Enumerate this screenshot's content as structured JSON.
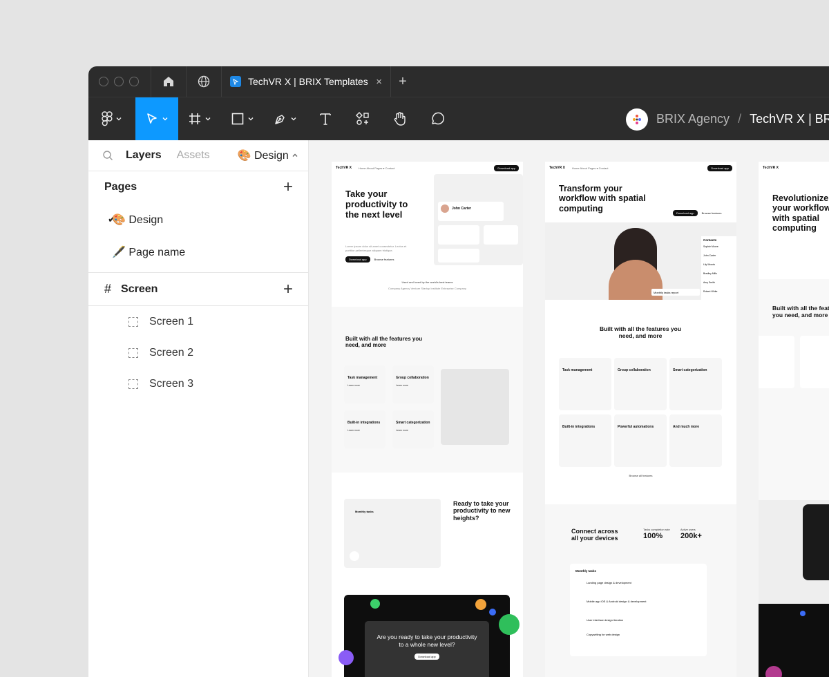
{
  "tabbar": {
    "tab_title": "TechVR X | BRIX Templates",
    "close_glyph": "×",
    "new_tab_glyph": "+"
  },
  "toolbar": {
    "breadcrumb_team": "BRIX Agency",
    "breadcrumb_sep": "/",
    "breadcrumb_file": "TechVR X | BRIX Templates",
    "active_tool": "move",
    "accent": "#0d99ff"
  },
  "sidebar": {
    "tabs": {
      "layers": "Layers",
      "assets": "Assets",
      "page": "🎨 Design"
    },
    "pages_title": "Pages",
    "pages": [
      {
        "label": "🎨 Design",
        "selected": true
      },
      {
        "label": "🖋️ Page name",
        "selected": false
      }
    ],
    "screen_title": "Screen",
    "layers": [
      "Screen 1",
      "Screen 2",
      "Screen 3"
    ]
  },
  "canvas": {
    "frame1": {
      "logo": "TechVR X",
      "nav": "Home   About   Pages ▾   Contact",
      "nav_btn": "Download app",
      "headline": "Take your productivity to the next level",
      "hero_para": "Lorem ipsum dolor sit amet consectetur. Lectus et porttitor pellentesque aliquam tristique.",
      "hero_btn": "Download app",
      "hero_link": "Browse features",
      "profile_name": "John Carter",
      "trusted": "Used and loved by the world's best teams",
      "logos": "Company   Agency   Venture   Startup   Institute   Enterprise   Company",
      "features_head": "Built with all the features you need, and more",
      "features": [
        "Task management",
        "Group collaboration",
        "Built-in integrations",
        "Smart categorization"
      ],
      "learn": "Learn more",
      "ready_head": "Ready to take your productivity to new heights?",
      "monthly": "Monthly tasks",
      "cta_head": "Are you ready to take your productivity to a whole new level?",
      "cta_btn": "Download app"
    },
    "frame2": {
      "logo": "TechVR X",
      "nav": "Home   About   Pages ▾   Contact",
      "nav_btn": "Download app",
      "headline": "Transform your workflow with spatial computing",
      "hero_btn": "Download app",
      "hero_link": "Browse features",
      "contacts_title": "Contacts",
      "contacts": [
        "Sophie Moore",
        "John Carter",
        "Lily Woods",
        "Bradley Mills",
        "Amy Smith",
        "Robert White"
      ],
      "monthly_report": "Monthly tasks report",
      "features_head": "Built with all the features you need, and more",
      "features": [
        "Task management",
        "Group collaboration",
        "Smart categorization",
        "Built-in integrations",
        "Powerful automations",
        "And much more"
      ],
      "browse_all": "Browse all features",
      "connect_head": "Connect across all your devices",
      "stat1_label": "Tasks completion rate",
      "stat1": "100%",
      "stat2_label": "Active users",
      "stat2": "200k+",
      "tasks_title": "Monthly tasks",
      "tasks": [
        "Landing page design & development",
        "Mobile app iOS & Android design & development",
        "User interface design iteration",
        "Copywriting for web design"
      ]
    },
    "frame3": {
      "logo": "TechVR X",
      "headline": "Revolutionize your workflow with spatial computing",
      "features_head": "Built with all the features you need, and more"
    }
  }
}
